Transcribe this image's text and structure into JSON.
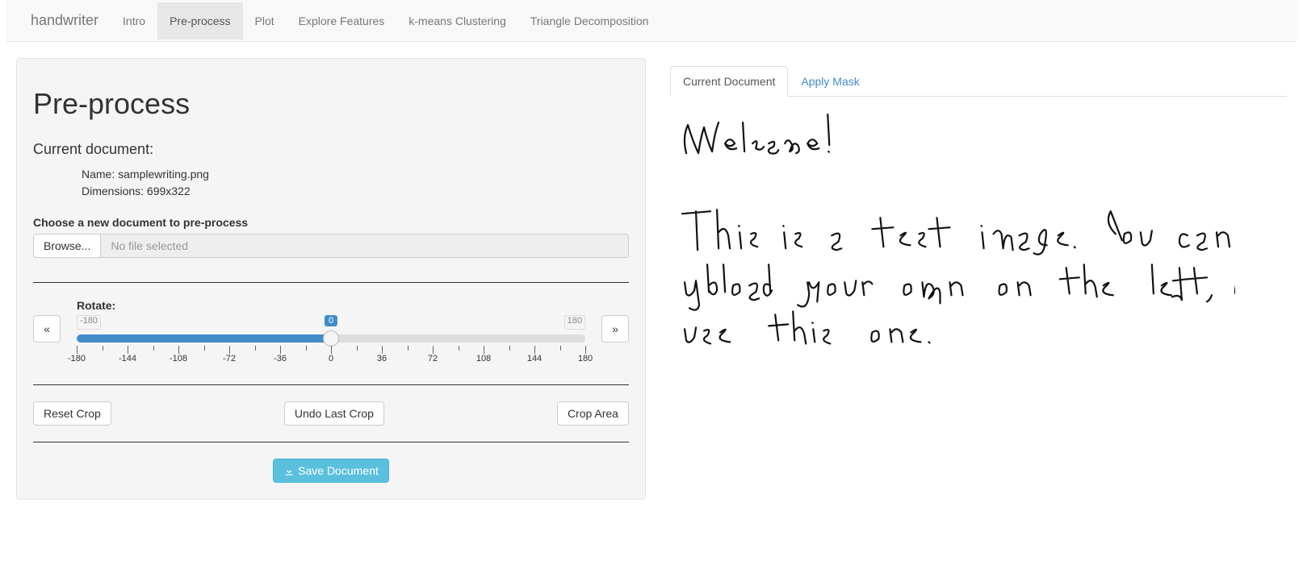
{
  "nav": {
    "brand": "handwriter",
    "items": [
      "Intro",
      "Pre-process",
      "Plot",
      "Explore Features",
      "k-means Clustering",
      "Triangle Decomposition"
    ],
    "active_index": 1
  },
  "panel": {
    "title": "Pre-process",
    "current_doc_heading": "Current document:",
    "name_label": "Name: ",
    "name_value": "samplewriting.png",
    "dims_label": "Dimensions: ",
    "dims_value": "699x322",
    "choose_label": "Choose a new document to pre-process",
    "browse_label": "Browse...",
    "file_placeholder": "No file selected",
    "rotate_label": "Rotate:",
    "slider_min": "-180",
    "slider_max": "180",
    "slider_value": "0",
    "slider_ticks": [
      "-180",
      "-144",
      "-108",
      "-72",
      "-36",
      "0",
      "36",
      "72",
      "108",
      "144",
      "180"
    ],
    "prev_glyph": "«",
    "next_glyph": "»",
    "reset_crop": "Reset Crop",
    "undo_crop": "Undo Last Crop",
    "crop_area": "Crop Area",
    "save_label": "Save Document"
  },
  "tabs": {
    "items": [
      "Current Document",
      "Apply Mask"
    ],
    "active_index": 0
  },
  "handwriting": {
    "line1": "Welcome!",
    "line2": "This is a test image. You can",
    "line3": "upload your own on the left, or",
    "line4": "use this one."
  }
}
